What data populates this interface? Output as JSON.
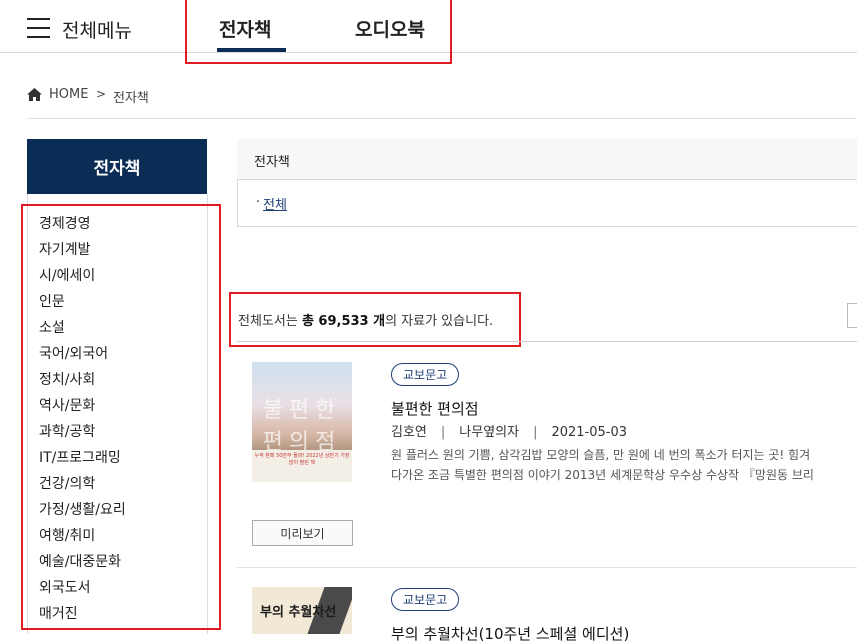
{
  "header": {
    "menu_label": "전체메뉴",
    "tabs": [
      {
        "label": "전자책",
        "active": true
      },
      {
        "label": "오디오북",
        "active": false
      }
    ]
  },
  "breadcrumb": {
    "home": "HOME",
    "separator": ">",
    "current": "전자책"
  },
  "sidebar": {
    "title": "전자책",
    "items": [
      {
        "label": "경제경영"
      },
      {
        "label": "자기계발"
      },
      {
        "label": "시/에세이"
      },
      {
        "label": "인문"
      },
      {
        "label": "소설"
      },
      {
        "label": "국어/외국어"
      },
      {
        "label": "정치/사회"
      },
      {
        "label": "역사/문화"
      },
      {
        "label": "과학/공학"
      },
      {
        "label": "IT/프로그래밍"
      },
      {
        "label": "건강/의학"
      },
      {
        "label": "가정/생활/요리"
      },
      {
        "label": "여행/취미"
      },
      {
        "label": "예술/대중문화"
      },
      {
        "label": "외국도서"
      },
      {
        "label": "매거진"
      }
    ]
  },
  "category_box": {
    "title": "전자책",
    "link_prefix": "·",
    "link": "전체"
  },
  "count": {
    "prefix": "전체도서는 ",
    "total": "총 69,533 개",
    "suffix": "의 자료가 있습니다."
  },
  "books": [
    {
      "badge": "교보문고",
      "cover_title": "불편한 편의점",
      "cover_text": "누적 판매 50만부 돌파! 2022년 상반기 가장 많이 팔린 책",
      "title": "불편한 편의점",
      "author": "김호연",
      "publisher": "나무옆의자",
      "date": "2021-05-03",
      "meta_sep": "|",
      "desc_line1": "원 플러스 원의 기쁨, 삼각김밥 모양의 슬픔, 만 원에 네 번의 폭소가 터지는 곳! 힘겨",
      "desc_line2": "다가온 조금 특별한 편의점 이야기 2013년 세계문학상 우수상 수상작 『망원동 브리",
      "preview": "미리보기"
    },
    {
      "badge": "교보문고",
      "cover_title": "부의 추월차선",
      "title": "부의 추월차선(10주년 스페셜 에디션)"
    }
  ]
}
